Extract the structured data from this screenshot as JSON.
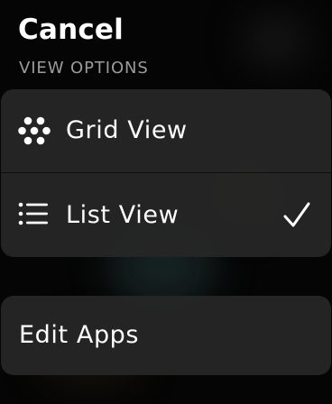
{
  "header": {
    "cancel_label": "Cancel",
    "section_title": "VIEW OPTIONS"
  },
  "options": [
    {
      "label": "Grid View",
      "icon": "grid-icon",
      "selected": false
    },
    {
      "label": "List View",
      "icon": "list-icon",
      "selected": true
    }
  ],
  "edit": {
    "label": "Edit Apps"
  },
  "colors": {
    "background": "#050505",
    "card": "#262626",
    "text": "#ffffff",
    "section_header": "#9b9b9b"
  }
}
